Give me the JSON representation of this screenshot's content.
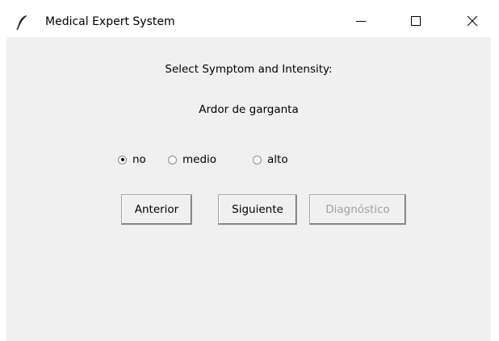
{
  "window": {
    "title": "Medical Expert System",
    "icon": "feather-icon",
    "controls": {
      "minimize_icon": "minimize-icon",
      "maximize_icon": "maximize-icon",
      "close_icon": "close-icon"
    }
  },
  "form": {
    "prompt": "Select Symptom and Intensity:",
    "symptom": "Ardor de garganta",
    "intensity_options": [
      {
        "label": "no",
        "selected": true
      },
      {
        "label": "medio",
        "selected": false
      },
      {
        "label": "alto",
        "selected": false
      }
    ]
  },
  "buttons": {
    "previous": "Anterior",
    "next": "Siguiente",
    "diagnosis": "Diagnóstico",
    "diagnosis_enabled": false
  },
  "colors": {
    "window_bg": "#f0f0f0",
    "titlebar_bg": "#ffffff",
    "disabled_text": "#a0a0a0"
  }
}
